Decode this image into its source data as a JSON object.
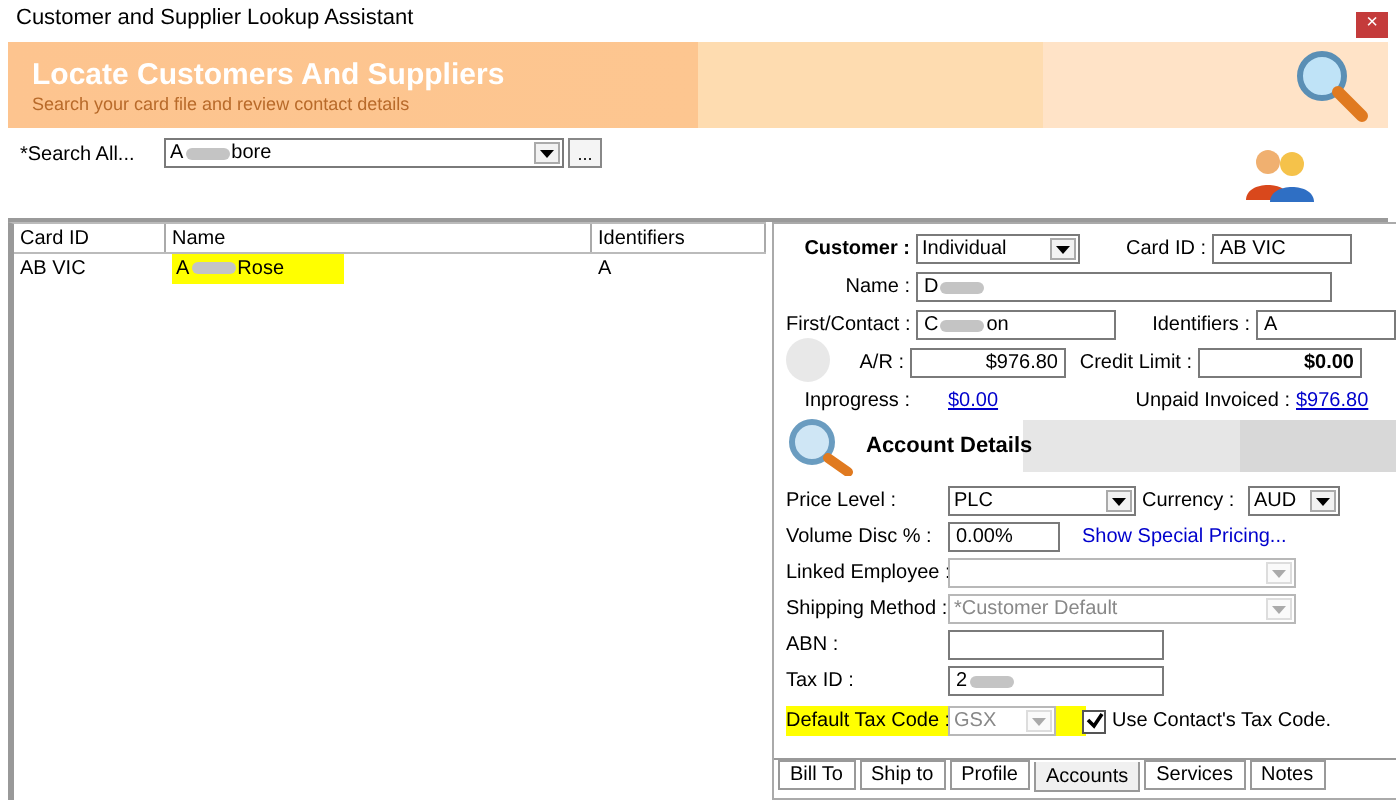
{
  "window": {
    "title": "Customer and Supplier Lookup Assistant",
    "close": "×"
  },
  "banner": {
    "title": "Locate Customers And Suppliers",
    "subtitle": "Search your card file and review contact details"
  },
  "search": {
    "label": "*Search All...",
    "value_parts": [
      "A",
      "bore"
    ],
    "browse": "..."
  },
  "table": {
    "columns": [
      "Card ID",
      "Name",
      "Identifiers"
    ],
    "rows": [
      {
        "cells": [
          {
            "parts": [
              "AB VIC"
            ]
          },
          {
            "parts": [
              "A",
              "Rose"
            ],
            "highlighted": true
          },
          {
            "parts": [
              "A"
            ]
          }
        ]
      }
    ]
  },
  "card": {
    "type_label": "Customer :",
    "type_value": "Individual",
    "card_id_label": "Card ID :",
    "card_id": "AB VIC",
    "name_label": "Name :",
    "name_parts": [
      "D"
    ],
    "contact_label": "First/Contact :",
    "contact_parts": [
      "C",
      "on"
    ],
    "identifiers_label": "Identifiers :",
    "identifiers": "A",
    "ar_label": "A/R :",
    "ar": "$976.80",
    "credit_label": "Credit Limit :",
    "credit": "$0.00",
    "inprogress_label": "Inprogress :",
    "inprogress": "$0.00",
    "unpaid_label": "Unpaid Invoiced :",
    "unpaid": "$976.80"
  },
  "account": {
    "title": "Account Details",
    "price_label": "Price Level :",
    "price": "PLC",
    "currency_label": "Currency :",
    "currency": "AUD",
    "disc_label": "Volume Disc % :",
    "disc": "0.00%",
    "special_link": "Show Special Pricing...",
    "employee_label": "Linked Employee :",
    "employee_disabled": true,
    "shipping_label": "Shipping Method :",
    "shipping": "*Customer Default",
    "shipping_disabled": true,
    "abn_label": "ABN :",
    "taxid_label": "Tax ID :",
    "taxid_parts": [
      "2"
    ],
    "taxcode_label": "Default Tax Code :",
    "taxcode": "GSX",
    "taxcode_disabled": true,
    "taxcode_highlighted": true,
    "use_contact_label": "Use Contact's Tax Code.",
    "use_contact_checked": true
  },
  "tabs": [
    {
      "label": "Bill To",
      "selected": false
    },
    {
      "label": "Ship to",
      "selected": false
    },
    {
      "label": "Profile",
      "selected": false
    },
    {
      "label": "Accounts",
      "selected": true
    },
    {
      "label": "Services",
      "selected": false
    },
    {
      "label": "Notes",
      "selected": false
    }
  ]
}
